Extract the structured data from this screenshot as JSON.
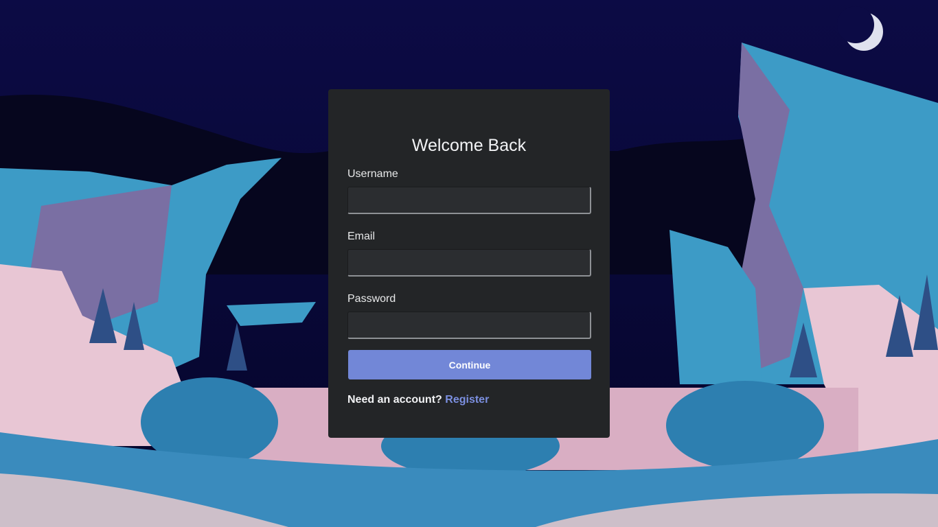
{
  "login": {
    "title": "Welcome Back",
    "fields": {
      "username": {
        "label": "Username",
        "value": "",
        "placeholder": ""
      },
      "email": {
        "label": "Email",
        "value": "",
        "placeholder": ""
      },
      "password": {
        "label": "Password",
        "value": "",
        "placeholder": ""
      }
    },
    "continue_label": "Continue",
    "footer": {
      "prompt": "Need an account?",
      "register_label": "Register"
    }
  },
  "colors": {
    "card_background": "#232527",
    "button": "#7287d7",
    "link": "#7b8fe0",
    "sky": "#0a0a3a"
  }
}
